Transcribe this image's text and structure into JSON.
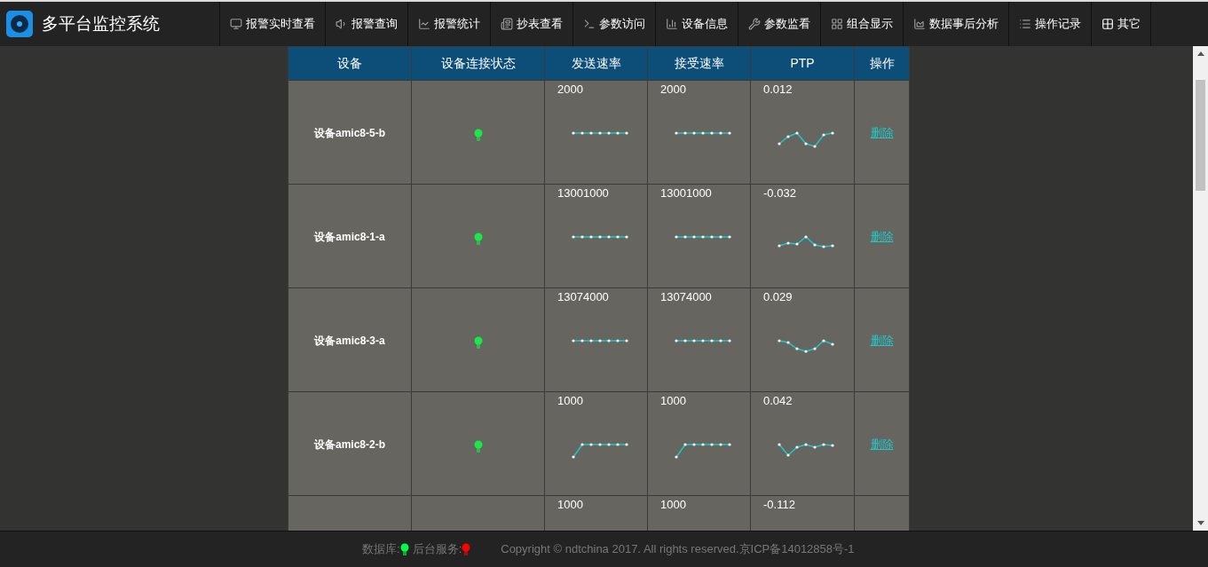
{
  "app_title": "多平台监控系统",
  "nav": [
    {
      "label": "报警实时查看"
    },
    {
      "label": "报警查询"
    },
    {
      "label": "报警统计"
    },
    {
      "label": "抄表查看"
    },
    {
      "label": "参数访问"
    },
    {
      "label": "设备信息"
    },
    {
      "label": "参数监看"
    },
    {
      "label": "组合显示"
    },
    {
      "label": "数据事后分析"
    },
    {
      "label": "操作记录"
    },
    {
      "label": "其它"
    }
  ],
  "table": {
    "columns": [
      "设备",
      "设备连接状态",
      "发送速率",
      "接受速率",
      "PTP",
      "操作"
    ],
    "rows": [
      {
        "device": "设备amic8-5-b",
        "connected": true,
        "send": "2000",
        "receive": "2000",
        "ptp": "0.012",
        "action": "删除"
      },
      {
        "device": "设备amic8-1-a",
        "connected": true,
        "send": "13001000",
        "receive": "13001000",
        "ptp": "-0.032",
        "action": "删除"
      },
      {
        "device": "设备amic8-3-a",
        "connected": true,
        "send": "13074000",
        "receive": "13074000",
        "ptp": "0.029",
        "action": "删除"
      },
      {
        "device": "设备amic8-2-b",
        "connected": true,
        "send": "1000",
        "receive": "1000",
        "ptp": "0.042",
        "action": "删除"
      },
      {
        "send": "1000",
        "receive": "1000",
        "ptp": "-0.112"
      }
    ]
  },
  "footer": {
    "statuses": [
      {
        "label": "数据库:",
        "color": "#00ff44"
      },
      {
        "label": "后台服务:",
        "color": "#ff0000"
      }
    ],
    "copyright": "Copyright © ndtchina 2017. All rights reserved.京ICP备14012858号-1"
  }
}
